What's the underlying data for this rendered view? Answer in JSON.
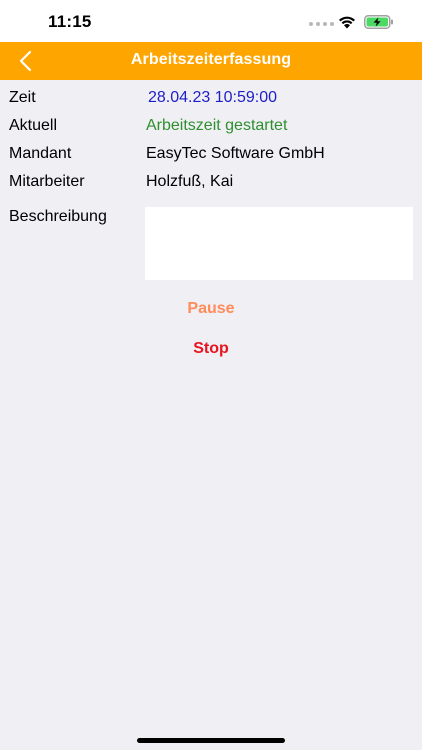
{
  "status_bar": {
    "time": "11:15"
  },
  "nav": {
    "title": "Arbeitszeiterfassung",
    "back_icon": "chevron-left-icon"
  },
  "form": {
    "rows": [
      {
        "label": "Zeit",
        "value": "28.04.23 10:59:00"
      },
      {
        "label": "Aktuell",
        "value": "Arbeitszeit gestartet"
      },
      {
        "label": "Mandant",
        "value": "EasyTec Software GmbH"
      },
      {
        "label": "Mitarbeiter",
        "value": "Holzfuß, Kai"
      }
    ],
    "description_label": "Beschreibung",
    "description_value": ""
  },
  "actions": {
    "pause_label": "Pause",
    "stop_label": "Stop"
  },
  "colors": {
    "accent": "#ffa500",
    "time_value": "#1e1ec8",
    "status_value": "#2f8f2f",
    "pause": "#ff8c5a",
    "stop": "#e8141e",
    "background": "#efeff4"
  }
}
